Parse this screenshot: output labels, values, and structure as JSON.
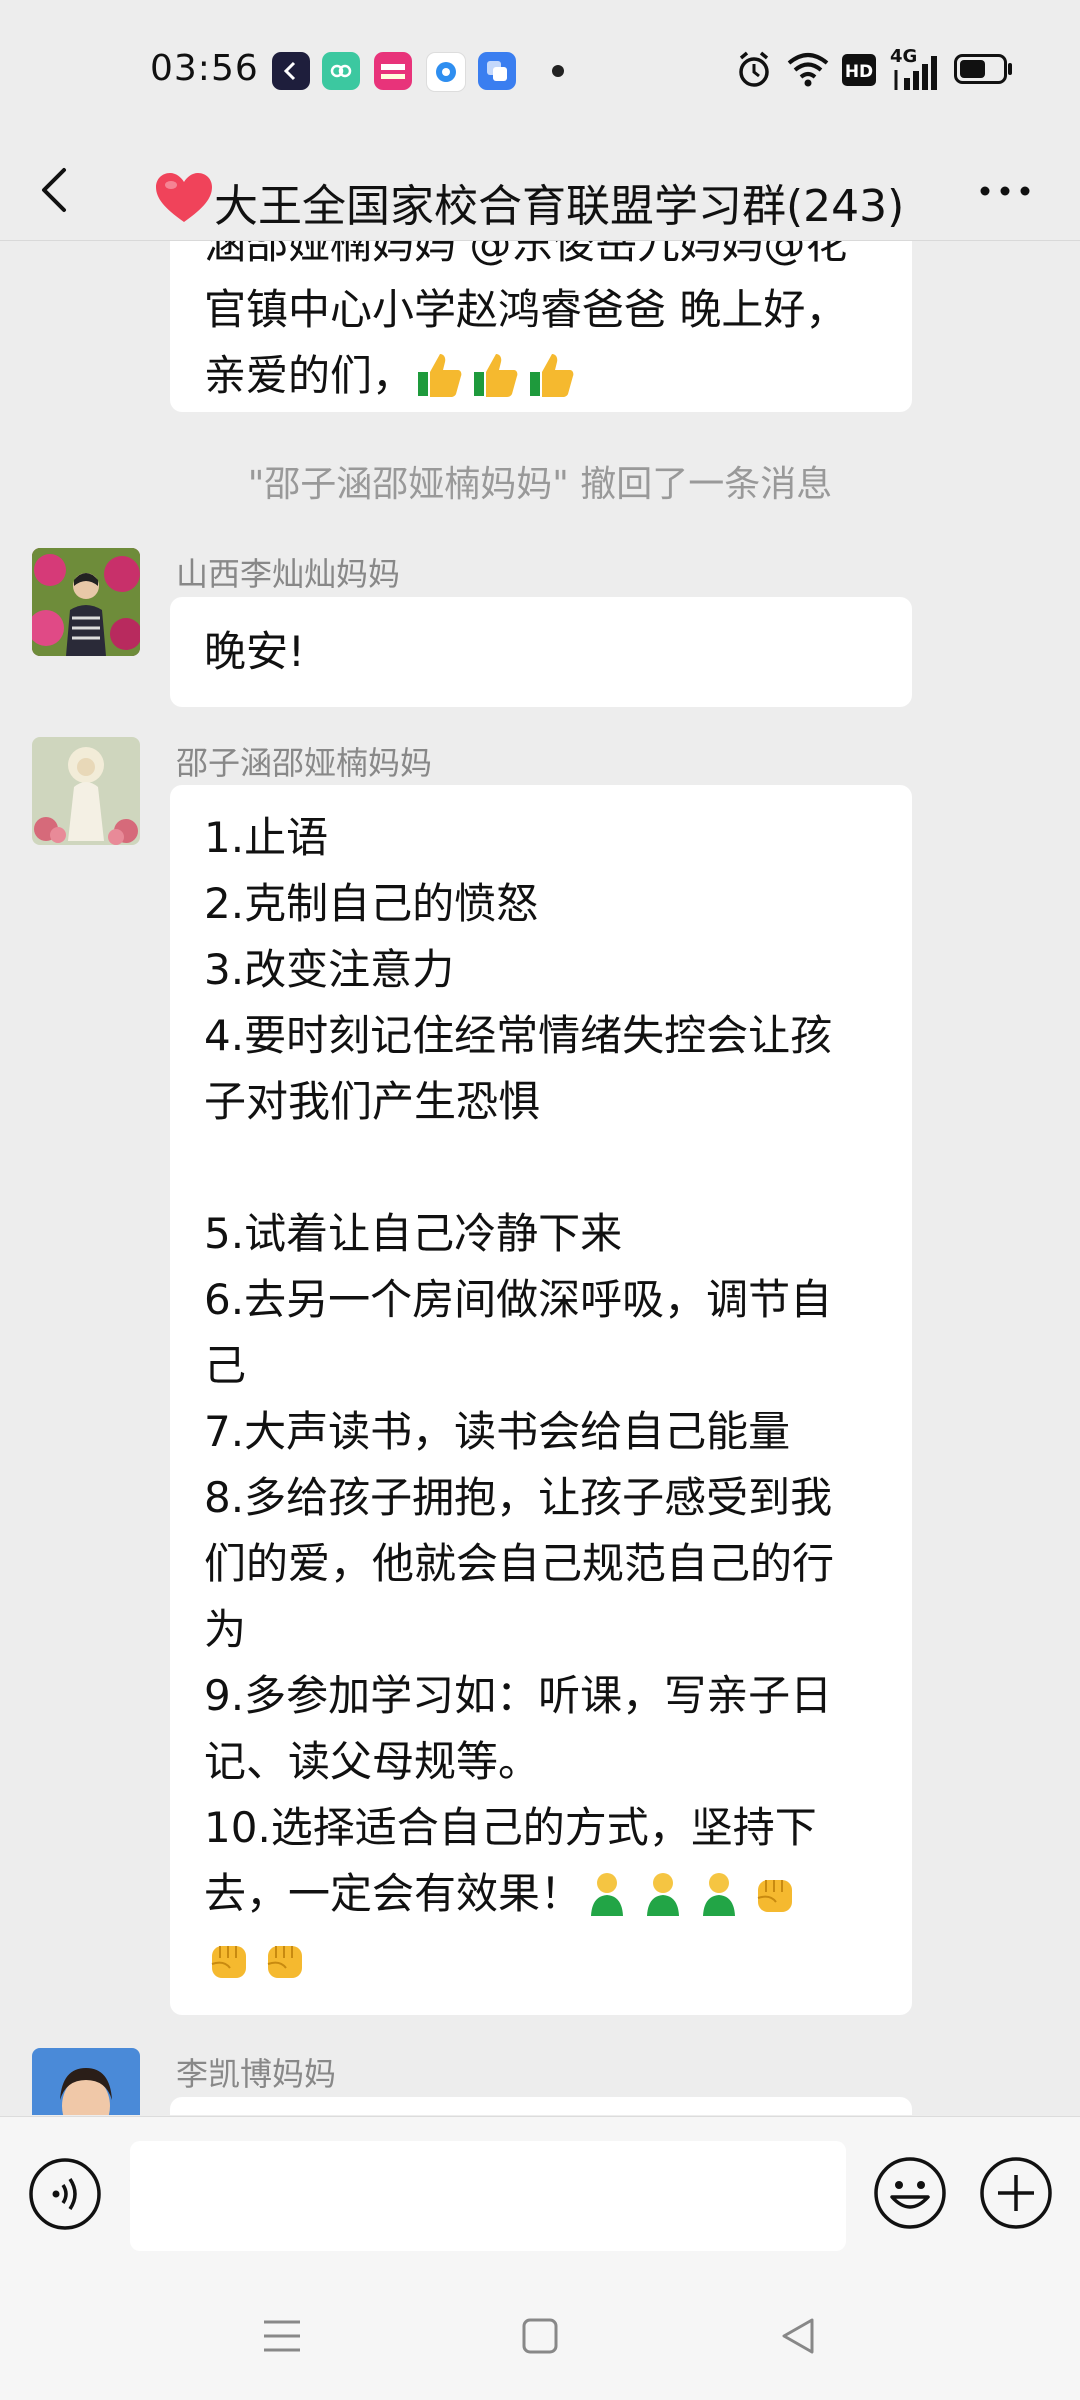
{
  "status_bar": {
    "time": "03:56",
    "notification_icons": [
      "kuaishou-icon",
      "wechat-mini-icon",
      "app-promo-icon",
      "browser-icon",
      "app-icon"
    ],
    "signal_label": "4G",
    "hd_label": "HD",
    "battery_level": 0.6
  },
  "header": {
    "title": "大王全国家校合育联盟学习群(243)",
    "title_prefix_icon": "red-heart-icon",
    "back_icon": "chevron-left-icon",
    "more_icon": "more-dots-icon"
  },
  "messages": {
    "partial_top": {
      "lines": [
        "涵邵娅楠妈妈 @东俊岳九妈妈@花",
        "官镇中心小学赵鸿睿爸爸   晚上好，",
        "亲爱的们，"
      ],
      "emojis": [
        "thumbs-up-icon",
        "thumbs-up-icon",
        "thumbs-up-icon"
      ]
    },
    "recall_notice": "\"邵子涵邵娅楠妈妈\" 撤回了一条消息",
    "msg_1": {
      "sender": "山西李灿灿妈妈",
      "text": "晚安!"
    },
    "msg_2": {
      "sender": "邵子涵邵娅楠妈妈",
      "lines": [
        "1.止语",
        "2.克制自己的愤怒",
        "3.改变注意力",
        "4.要时刻记住经常情绪失控会让孩",
        "子对我们产生恐惧",
        "",
        "5.试着让自己冷静下来",
        "6.去另一个房间做深呼吸，调节自",
        "己",
        "7.大声读书，读书会给自己能量",
        "8.多给孩子拥抱，让孩子感受到我",
        "们的爱，他就会自己规范自己的行",
        "为",
        "9.多参加学习如：听课，写亲子日",
        "记、读父母规等。",
        "10.选择适合自己的方式，坚持下",
        "去，一定会有效果！"
      ],
      "end_emojis_line1": [
        "person-green-icon",
        "person-green-icon",
        "person-green-icon",
        "fist-icon"
      ],
      "end_emojis_line2": [
        "fist-icon",
        "fist-icon"
      ]
    },
    "msg_3": {
      "sender": "李凯博妈妈"
    }
  },
  "input_bar": {
    "value": "",
    "placeholder": "",
    "voice_icon": "voice-icon",
    "emoji_icon": "smiley-icon",
    "plus_icon": "plus-circle-icon"
  },
  "nav_bar": {
    "icons": [
      "menu-icon",
      "home-square-icon",
      "back-triangle-icon"
    ]
  },
  "colors": {
    "background": "#ededed",
    "bubble": "#ffffff",
    "meta_text": "#888888",
    "recall_text": "#999999",
    "heart": "#f0435a"
  }
}
